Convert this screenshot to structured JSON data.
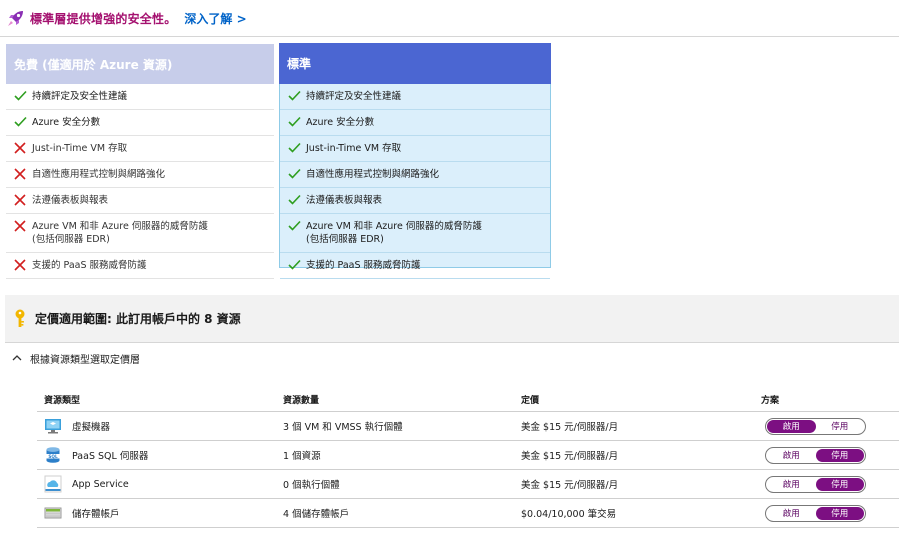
{
  "banner": {
    "icon": "rocket-icon",
    "title": "標準層提供增強的安全性。",
    "link": "深入了解 >",
    "title_color": "#a4106f",
    "link_color": "#0063c8"
  },
  "tiers": {
    "free": {
      "title": "免費 (僅適用於 Azure 資源)",
      "header_color": "#c7cdea",
      "features": [
        {
          "label": "持續評定及安全性建議",
          "included": true
        },
        {
          "label": "Azure 安全分數",
          "included": true
        },
        {
          "label": "Just-in-Time VM 存取",
          "included": false
        },
        {
          "label": "自適性應用程式控制與網路強化",
          "included": false
        },
        {
          "label": "法遵儀表板與報表",
          "included": false
        },
        {
          "label": "Azure VM 和非 Azure 伺服器的威脅防護\n(包括伺服器 EDR)",
          "included": false
        },
        {
          "label": "支援的 PaaS 服務威脅防護",
          "included": false
        }
      ]
    },
    "standard": {
      "title": "標準",
      "header_color": "#4b66d2",
      "selected": true,
      "features": [
        {
          "label": "持續評定及安全性建議",
          "included": true
        },
        {
          "label": "Azure 安全分數",
          "included": true
        },
        {
          "label": "Just-in-Time VM 存取",
          "included": true
        },
        {
          "label": "自適性應用程式控制與網路強化",
          "included": true
        },
        {
          "label": "法遵儀表板與報表",
          "included": true
        },
        {
          "label": "Azure VM 和非 Azure 伺服器的威脅防護\n(包括伺服器 EDR)",
          "included": true
        },
        {
          "label": "支援的 PaaS 服務威脅防護",
          "included": true
        }
      ]
    }
  },
  "scope": {
    "icon": "key-icon",
    "title": "定價適用範圍: 此訂用帳戶中的 8 資源"
  },
  "section": {
    "icon": "chevron-up-icon",
    "label": "根據資源類型選取定價層"
  },
  "table": {
    "headers": [
      "資源類型",
      "資源數量",
      "定價",
      "方案"
    ],
    "rows": [
      {
        "icon": "virtual-machine-icon",
        "type": "虛擬機器",
        "count": "3 個 VM 和 VMSS 執行個體",
        "price": "美金 $15 元/伺服器/月",
        "on_label": "啟用",
        "off_label": "停用",
        "state": "on"
      },
      {
        "icon": "sql-icon",
        "type": "PaaS SQL 伺服器",
        "count": "1 個資源",
        "price": "美金 $15 元/伺服器/月",
        "on_label": "啟用",
        "off_label": "停用",
        "state": "off"
      },
      {
        "icon": "app-service-icon",
        "type": "App Service",
        "count": "0 個執行個體",
        "price": "美金 $15 元/伺服器/月",
        "on_label": "啟用",
        "off_label": "停用",
        "state": "off"
      },
      {
        "icon": "storage-account-icon",
        "type": "儲存體帳戶",
        "count": "4 個儲存體帳戶",
        "price": "$0.04/10,000 筆交易",
        "on_label": "啟用",
        "off_label": "停用",
        "state": "off"
      }
    ]
  },
  "colors": {
    "check": "#2e9e1f",
    "cross": "#d21f1f",
    "toggle_on": "#7c0f82"
  }
}
